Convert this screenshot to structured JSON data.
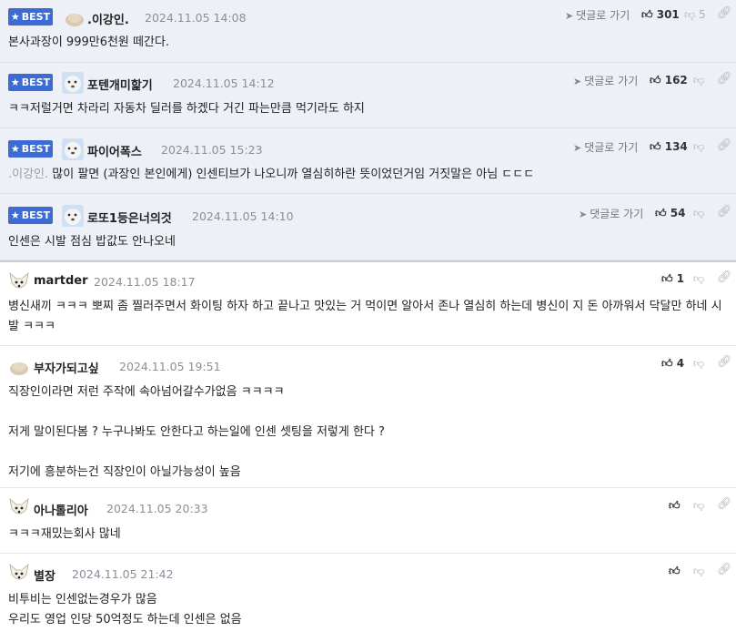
{
  "ui": {
    "best_label": "BEST",
    "goto_label": "댓글로 가기"
  },
  "comments": [
    {
      "best": true,
      "nick": ".이강인.",
      "date": "2024.11.05 14:08",
      "likes": "301",
      "dislikes": "5",
      "avatar": "blob",
      "text": "본사과장이 999만6천원 떼간다."
    },
    {
      "best": true,
      "nick": "포텐개미핥기",
      "date": "2024.11.05 14:12",
      "likes": "162",
      "dislikes": "",
      "avatar": "dog-blue",
      "text": "ㅋㅋ저럴거면 차라리 자동차 딜러를 하겠다 거긴 파는만큼 먹기라도 하지"
    },
    {
      "best": true,
      "nick": "파이어폭스",
      "date": "2024.11.05 15:23",
      "likes": "134",
      "dislikes": "",
      "avatar": "dog-blue",
      "quote": ".이강인.",
      "text": "많이 팔면 (과장인 본인에게) 인센티브가 나오니까 열심히하란 뜻이었던거임 거짓말은 아님 ㄷㄷㄷ"
    },
    {
      "best": true,
      "nick": "로또1등은너의것",
      "date": "2024.11.05 14:10",
      "likes": "54",
      "dislikes": "",
      "avatar": "dog-blue",
      "text": "인센은 시발 점심 밥값도 안나오네"
    },
    {
      "best": false,
      "nick": "martder",
      "date": "2024.11.05 18:17",
      "likes": "1",
      "dislikes": "",
      "avatar": "fox",
      "text": "병신새끼 ㅋㅋㅋ 뽀찌 좀 찔러주면서 화이팅 하자 하고 끝나고 맛있는 거 먹이면 알아서 존나 열심히 하는데 병신이 지 돈 아까워서 닥달만 하네 시발 ㅋㅋㅋ"
    },
    {
      "best": false,
      "nick": "부자가되고싶",
      "date": "2024.11.05 19:51",
      "likes": "4",
      "dislikes": "",
      "avatar": "blob",
      "lines": [
        "직장인이라면 저런 주작에 속아넘어갈수가없음 ㅋㅋㅋㅋ",
        "",
        "저게 말이된다봄 ? 누구나봐도 안한다고 하는일에 인센 셋팅을 저렇게 한다 ?",
        "",
        "저기에 흥분하는건 직장인이 아닐가능성이 높음"
      ]
    },
    {
      "best": false,
      "nick": "아나톨리아",
      "date": "2024.11.05 20:33",
      "likes": "",
      "dislikes": "",
      "avatar": "fox",
      "text": "ㅋㅋㅋ재밌는회사 많네"
    },
    {
      "best": false,
      "nick": "별장",
      "date": "2024.11.05 21:42",
      "likes": "",
      "dislikes": "",
      "avatar": "fox",
      "lines": [
        "비투비는 인센없는경우가 많음",
        "우리도 영업 인당 50억정도 하는데 인센은 없음"
      ]
    }
  ]
}
